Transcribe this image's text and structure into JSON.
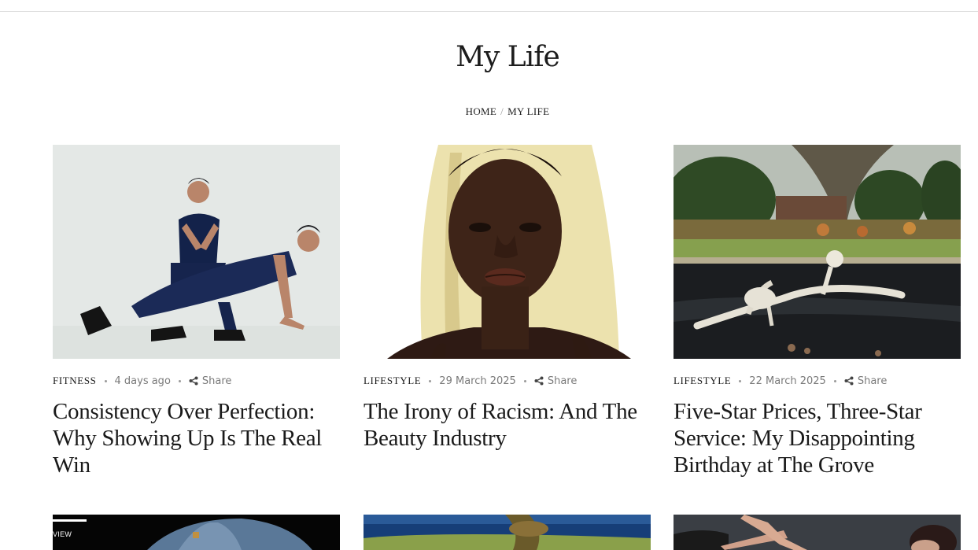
{
  "page": {
    "title": "My Life",
    "breadcrumb": {
      "home": "HOME",
      "separator": "/",
      "current": "MY LIFE"
    }
  },
  "posts": [
    {
      "category": "FITNESS",
      "date": "4 days ago",
      "share": "Share",
      "title": "Consistency Over Perfection: Why Showing Up Is The Real Win",
      "image": "two-boys-exercising-photo"
    },
    {
      "category": "LIFESTYLE",
      "date": "29 March 2025",
      "share": "Share",
      "title": "The Irony of Racism: And The Beauty Industry",
      "image": "woman-portrait-headscarf-photo"
    },
    {
      "category": "LIFESTYLE",
      "date": "22 March 2025",
      "share": "Share",
      "title": "Five-Star Prices, Three-Star Service: My Disappointing Birthday at The Grove",
      "image": "skeleton-sculpture-pond-photo"
    }
  ],
  "next_row": [
    {
      "image": "denim-jacket-photo",
      "badge": "VIEW"
    },
    {
      "image": "underwater-figure-photo"
    },
    {
      "image": "hands-reaching-photo"
    }
  ],
  "colors": {
    "text": "#1a1a1a",
    "meta_gray": "#7a7a7a",
    "divider": "#dcdcdc"
  }
}
